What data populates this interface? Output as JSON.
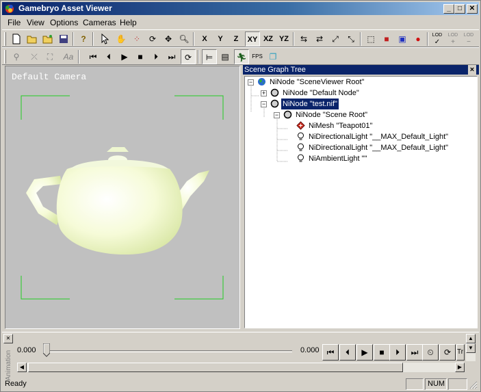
{
  "window": {
    "title": "Gamebryo Asset Viewer",
    "minimize": "_",
    "maximize": "□",
    "close": "✕"
  },
  "menu": [
    "File",
    "View",
    "Options",
    "Cameras",
    "Help"
  ],
  "toolbar1": {
    "axis_buttons": [
      "X",
      "Y",
      "Z",
      "XY",
      "XZ",
      "YZ"
    ],
    "pressed_axis": "XY",
    "lod_labels": [
      "LOD",
      "LOD",
      "LOD"
    ]
  },
  "toolbar2": {
    "fps_label": "FPS",
    "text_label": "Aa"
  },
  "viewport": {
    "camera_label": "Default Camera",
    "background": "#c0c0c0",
    "frame_color": "#22cc22"
  },
  "scene_graph": {
    "title": "Scene Graph Tree",
    "close": "×",
    "nodes": [
      {
        "label": "NiNode \"SceneViewer Root\"",
        "expander": "−",
        "icon": "globe-icon"
      },
      {
        "label": "NiNode \"Default Node\"",
        "expander": "+",
        "icon": "node-icon"
      },
      {
        "label": "NiNode \"test.nif\"",
        "expander": "−",
        "icon": "node-icon",
        "selected": true
      },
      {
        "label": "NiNode \"Scene Root\"",
        "expander": "−",
        "icon": "node-icon"
      },
      {
        "label": "NiMesh \"Teapot01\"",
        "expander": "",
        "icon": "mesh-icon"
      },
      {
        "label": "NiDirectionalLight \"__MAX_Default_Light\"",
        "expander": "",
        "icon": "light-icon"
      },
      {
        "label": "NiDirectionalLight \"__MAX_Default_Light\"",
        "expander": "",
        "icon": "light-icon"
      },
      {
        "label": "NiAmbientLight \"\"",
        "expander": "",
        "icon": "light-icon"
      }
    ]
  },
  "animation": {
    "side_label": "Animation",
    "start_time": "0.000",
    "end_time": "0.000",
    "playback_buttons": [
      "first-frame",
      "prev-frame",
      "play",
      "stop",
      "next-frame",
      "last-frame",
      "clock",
      "loop"
    ],
    "truncated_label": "Tr"
  },
  "status": {
    "text": "Ready",
    "num": "NUM"
  },
  "colors": {
    "titlebar_start": "#0a246a",
    "titlebar_end": "#a6caf0",
    "selection": "#0a246a"
  }
}
